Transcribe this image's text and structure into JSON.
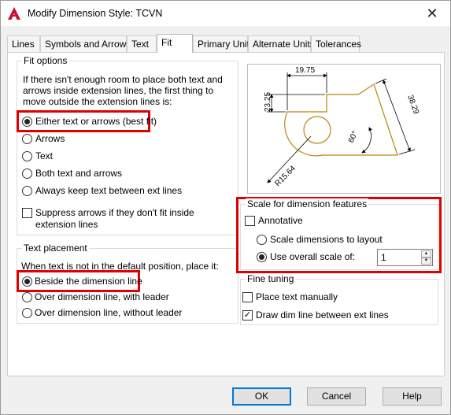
{
  "window": {
    "title": "Modify Dimension Style: TCVN"
  },
  "tabs": [
    {
      "label": "Lines"
    },
    {
      "label": "Symbols and Arrows"
    },
    {
      "label": "Text"
    },
    {
      "label": "Fit"
    },
    {
      "label": "Primary Units"
    },
    {
      "label": "Alternate Units"
    },
    {
      "label": "Tolerances"
    }
  ],
  "active_tab": "Fit",
  "fit_options": {
    "title": "Fit options",
    "description": [
      "If there isn't enough room to place both text and",
      "arrows inside extension lines, the first thing to",
      "move outside the extension lines is:"
    ],
    "options": [
      {
        "label": "Either text or arrows (best fit)",
        "checked": true
      },
      {
        "label": "Arrows",
        "checked": false
      },
      {
        "label": "Text",
        "checked": false
      },
      {
        "label": "Both text and arrows",
        "checked": false
      },
      {
        "label": "Always keep text between ext lines",
        "checked": false
      }
    ],
    "suppress": {
      "label_line1": "Suppress arrows if they don't fit inside",
      "label_line2": "extension lines",
      "checked": false
    }
  },
  "text_placement": {
    "title": "Text placement",
    "description": "When text is not in the default position, place it:",
    "options": [
      {
        "label": "Beside the dimension line",
        "checked": true
      },
      {
        "label": "Over dimension line, with leader",
        "checked": false
      },
      {
        "label": "Over dimension line, without leader",
        "checked": false
      }
    ]
  },
  "preview": {
    "dim_top": "19.75",
    "dim_left": "23.25",
    "dim_right": "38.29",
    "dim_angle": "60°",
    "dim_radius": "R15.64"
  },
  "scale": {
    "title": "Scale for dimension features",
    "annotative": {
      "label": "Annotative",
      "checked": false
    },
    "scale_to_layout": {
      "label": "Scale dimensions to layout",
      "checked": false
    },
    "overall_scale": {
      "label": "Use overall scale of:",
      "checked": true,
      "value": "1"
    }
  },
  "fine_tuning": {
    "title": "Fine tuning",
    "place_manually": {
      "label": "Place text manually",
      "checked": false
    },
    "draw_dim_line": {
      "label": "Draw dim line between ext lines",
      "checked": true
    }
  },
  "buttons": {
    "ok": "OK",
    "cancel": "Cancel",
    "help": "Help"
  },
  "colors": {
    "highlight": "#e00000",
    "preview_shape": "#b8860b",
    "app_icon": "#c8102e"
  }
}
